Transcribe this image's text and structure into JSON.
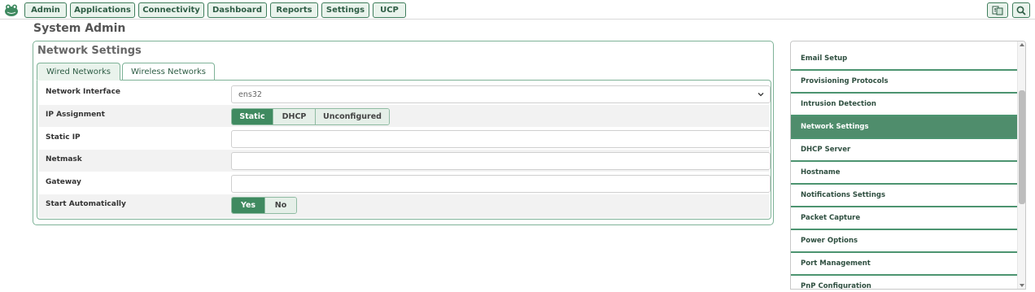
{
  "nav": {
    "items": [
      "Admin",
      "Applications",
      "Connectivity",
      "Dashboard",
      "Reports",
      "Settings",
      "UCP"
    ],
    "right_icons": [
      "language-icon",
      "search-icon"
    ]
  },
  "page": {
    "title": "System Admin"
  },
  "network_settings": {
    "title": "Network Settings",
    "tabs": [
      "Wired Networks",
      "Wireless Networks"
    ],
    "active_tab": "Wired Networks",
    "fields": {
      "interface_label": "Network Interface",
      "interface_value": "ens32",
      "ip_assignment_label": "IP Assignment",
      "ip_assignment_options": [
        "Static",
        "DHCP",
        "Unconfigured"
      ],
      "ip_assignment_selected": "Static",
      "static_ip_label": "Static IP",
      "static_ip_value": "",
      "netmask_label": "Netmask",
      "netmask_value": "",
      "gateway_label": "Gateway",
      "gateway_value": "",
      "start_auto_label": "Start Automatically",
      "start_auto_options": [
        "Yes",
        "No"
      ],
      "start_auto_selected": "Yes"
    }
  },
  "sidebar": {
    "items": [
      "Email Setup",
      "Provisioning Protocols",
      "Intrusion Detection",
      "Network Settings",
      "DHCP Server",
      "Hostname",
      "Notifications Settings",
      "Packet Capture",
      "Power Options",
      "Port Management",
      "PnP Configuration"
    ],
    "active": "Network Settings"
  },
  "colors": {
    "accent": "#3f8a60",
    "accent_light": "#e9f3ec",
    "border": "#7fb398"
  }
}
